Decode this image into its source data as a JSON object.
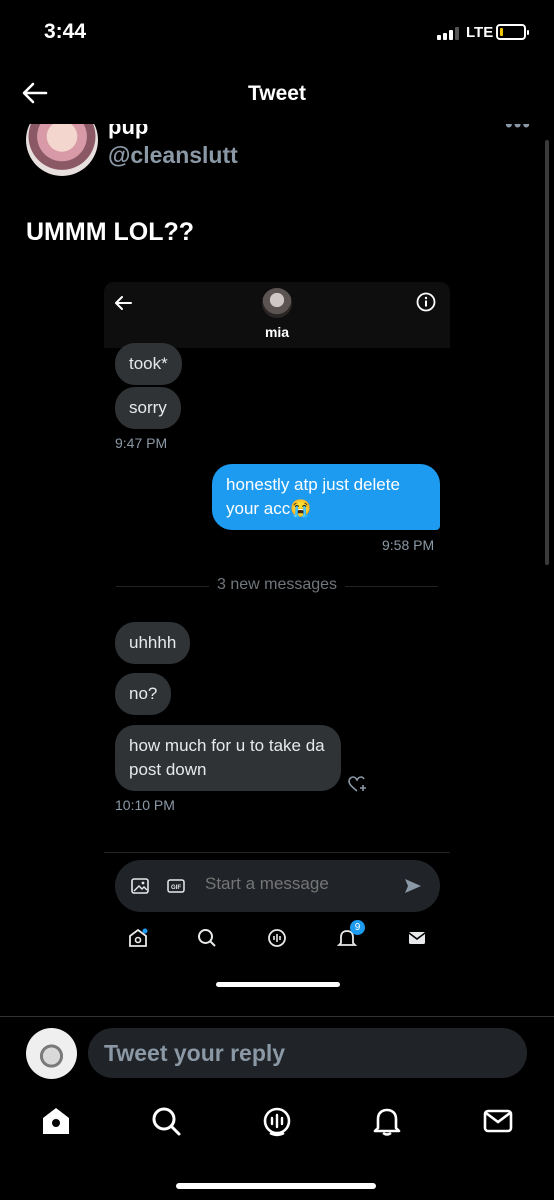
{
  "status_bar": {
    "time": "3:44",
    "network": "LTE"
  },
  "header": {
    "title": "Tweet"
  },
  "tweet": {
    "author_name": "pup",
    "author_handle": "@cleanslutt",
    "more": "•••",
    "text": "UMMM LOL??"
  },
  "screenshot": {
    "contact_name": "mia",
    "messages": [
      {
        "text": "took*",
        "direction": "incoming"
      },
      {
        "text": "sorry",
        "direction": "incoming"
      },
      {
        "text": "honestly atp just delete your acc😭",
        "direction": "outgoing"
      },
      {
        "text": "uhhhh",
        "direction": "incoming"
      },
      {
        "text": "no?",
        "direction": "incoming"
      },
      {
        "text": "how much for u to take da post down",
        "direction": "incoming"
      }
    ],
    "timestamps": [
      "9:47 PM",
      "9:58 PM",
      "10:10 PM"
    ],
    "divider_text": "3 new messages",
    "compose_placeholder": "Start a message",
    "gif_label": "GIF",
    "notification_badge": "9"
  },
  "reply": {
    "placeholder": "Tweet your reply"
  },
  "colors": {
    "accent": "#1d9bf0",
    "background": "#000000",
    "muted": "#8b98a5",
    "bubble": "#2f3336"
  }
}
